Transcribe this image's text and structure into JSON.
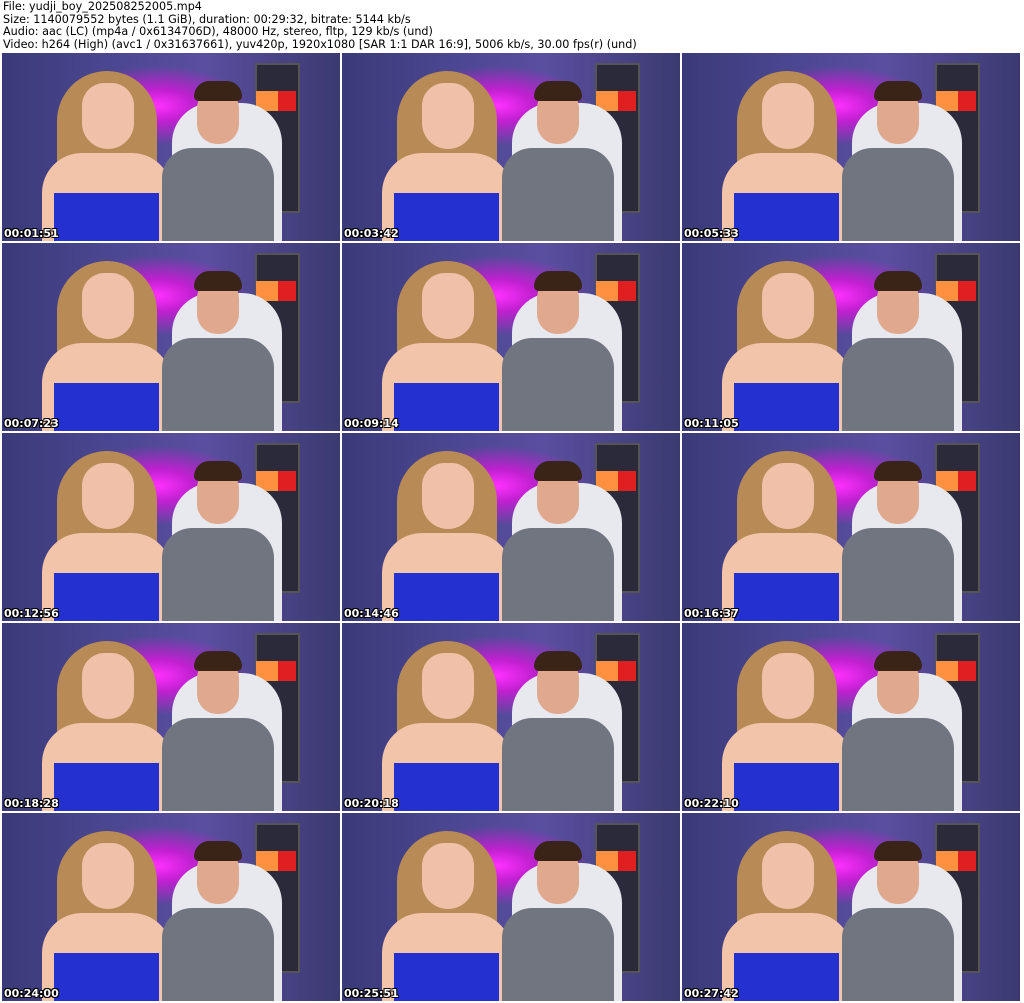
{
  "header": {
    "file": "File: yudji_boy_202508252005.mp4",
    "size": "Size: 1140079552 bytes (1.1 GiB), duration: 00:29:32, bitrate: 5144 kb/s",
    "audio": "Audio: aac (LC) (mp4a / 0x6134706D), 48000 Hz, stereo, fltp, 129 kb/s (und)",
    "video": "Video: h264 (High) (avc1 / 0x31637661), yuv420p, 1920x1080 [SAR 1:1 DAR 16:9], 5006 kb/s, 30.00 fps(r) (und)"
  },
  "thumbnails": [
    "00:01:51",
    "00:03:42",
    "00:05:33",
    "00:07:23",
    "00:09:14",
    "00:11:05",
    "00:12:56",
    "00:14:46",
    "00:16:37",
    "00:18:28",
    "00:20:18",
    "00:22:10",
    "00:24:00",
    "00:25:51",
    "00:27:42"
  ]
}
